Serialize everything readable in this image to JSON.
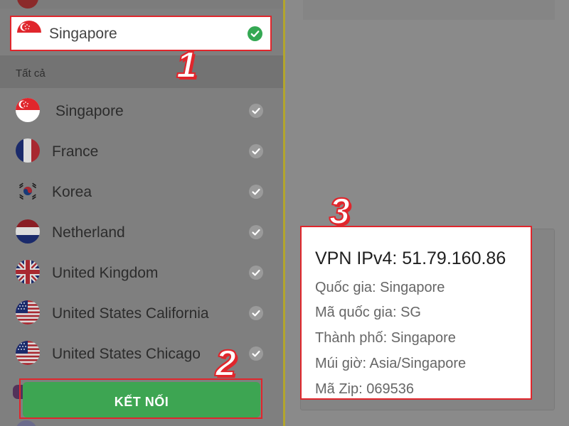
{
  "selected_server": {
    "name": "Singapore",
    "flag": "singapore-flag"
  },
  "section": {
    "label": "Tất cả"
  },
  "countries": [
    {
      "name": "Singapore",
      "flag": "singapore-flag"
    },
    {
      "name": "France",
      "flag": "france-flag"
    },
    {
      "name": "Korea",
      "flag": "korea-flag"
    },
    {
      "name": "Netherland",
      "flag": "netherlands-flag"
    },
    {
      "name": "United Kingdom",
      "flag": "uk-flag"
    },
    {
      "name": "United States California",
      "flag": "us-flag"
    },
    {
      "name": "United States Chicago",
      "flag": "us-flag"
    }
  ],
  "connect": {
    "label": "KẾT NỐI"
  },
  "info": {
    "ip_line": "VPN IPv4: 51.79.160.86",
    "country_line": "Quốc gia: Singapore",
    "country_code_line": "Mã quốc gia: SG",
    "city_line": "Thành phố: Singapore",
    "timezone_line": "Múi giờ: Asia/Singapore",
    "zip_line": "Mã Zip: 069536"
  },
  "steps": {
    "one": "1",
    "two": "2",
    "three": "3"
  },
  "colors": {
    "highlight": "#e0262c",
    "connect_green": "#3da552",
    "check_green": "#34a853",
    "divider": "#b3a52c"
  }
}
